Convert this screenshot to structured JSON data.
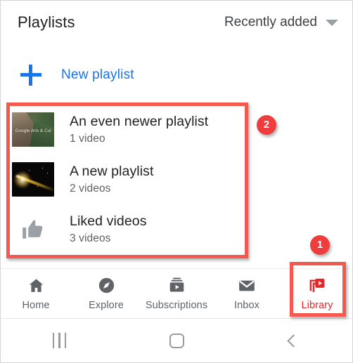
{
  "header": {
    "title": "Playlists",
    "sort_label": "Recently added",
    "caret_icon": "chevron-down-icon"
  },
  "new_playlist": {
    "label": "New playlist",
    "plus_icon": "plus-icon",
    "accent_color": "#1a73e8"
  },
  "playlists": [
    {
      "title": "An even newer playlist",
      "count": "1 video",
      "thumb_kind": "image",
      "thumb_name": "thumbnail-google-arts-culture",
      "thumb_watermark": "Google Arts & Cul"
    },
    {
      "title": "A new playlist",
      "count": "2 videos",
      "thumb_kind": "image",
      "thumb_name": "thumbnail-light-streak",
      "thumb_watermark": ""
    },
    {
      "title": "Liked videos",
      "count": "3 videos",
      "thumb_kind": "icon",
      "thumb_name": "thumbs-up-icon",
      "thumb_watermark": ""
    }
  ],
  "tabs": [
    {
      "label": "Home",
      "icon": "home-icon",
      "active": false
    },
    {
      "label": "Explore",
      "icon": "compass-icon",
      "active": false
    },
    {
      "label": "Subscriptions",
      "icon": "subscriptions-icon",
      "active": false
    },
    {
      "label": "Inbox",
      "icon": "envelope-icon",
      "active": false
    },
    {
      "label": "Library",
      "icon": "library-icon",
      "active": true
    }
  ],
  "system_nav": {
    "recents_icon": "recents-icon",
    "home_icon": "home-square-icon",
    "back_icon": "back-chevron-icon"
  },
  "annotations": {
    "badge_one": "1",
    "badge_two": "2",
    "highlight_color": "#f4584f",
    "badge_color": "#ef3d3d"
  }
}
